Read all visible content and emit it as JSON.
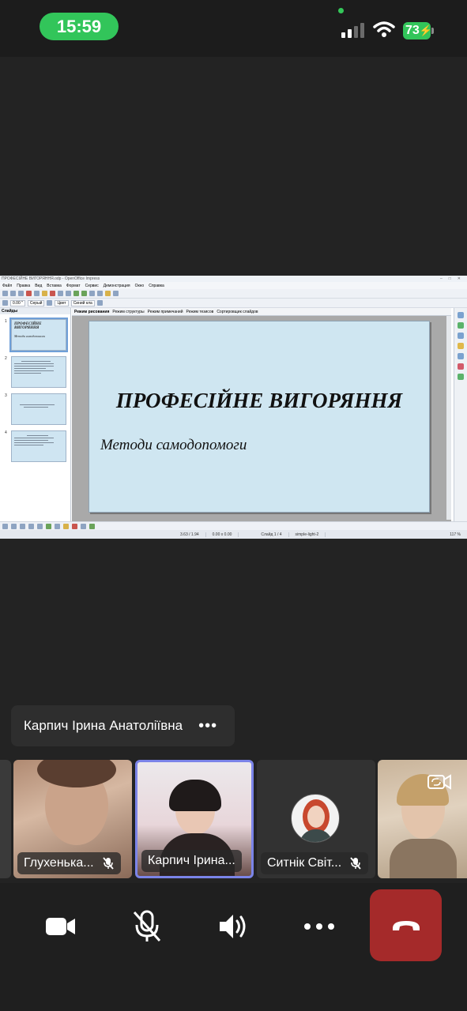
{
  "status": {
    "time": "15:59",
    "battery": "73"
  },
  "colors": {
    "time_pill": "#32c55a",
    "active_border": "#7b84e8",
    "leave_button": "#a52a2a"
  },
  "shared_screen": {
    "window_title": "ПРОФЕСІЙНЕ ВИГОРЯННЯ.odp - OpenOffice Impress",
    "menu": [
      "Файл",
      "Правка",
      "Вид",
      "Вставка",
      "Формат",
      "Сервис",
      "Демонстрация",
      "Окно",
      "Справка"
    ],
    "toolbar_fields": [
      "0.00 \"",
      "Серый",
      "Цвет",
      "Синий кла"
    ],
    "slides_panel_title": "Слайды",
    "view_tabs": [
      "Режим рисования",
      "Режим структуры",
      "Режим примечаний",
      "Режим тезисов",
      "Сортировщик слайдов"
    ],
    "thumbnails": [
      {
        "num": "1",
        "title": "ПРОФЕСІЙНЕ ВИГОРЯННЯ",
        "sub": "Методи самодопомоги"
      },
      {
        "num": "2",
        "title": "",
        "sub": ""
      },
      {
        "num": "3",
        "title": "",
        "sub": ""
      },
      {
        "num": "4",
        "title": "",
        "sub": ""
      }
    ],
    "slide": {
      "title": "ПРОФЕСІЙНЕ ВИГОРЯННЯ",
      "subtitle": "Методи самодопомоги"
    },
    "status_bar": {
      "position": "3.63 / 1.94",
      "size": "0.00 x 0.00",
      "slide": "Слайд 1 / 4",
      "layout": "simple-light-2",
      "zoom": "117 %"
    }
  },
  "active_speaker": {
    "name": "Карпич Ірина Анатоліївна",
    "more": "•••"
  },
  "participants": [
    {
      "name": "",
      "muted": false
    },
    {
      "name": "Глухенька...",
      "muted": true
    },
    {
      "name": "Карпич Ірина...",
      "muted": false
    },
    {
      "name": "Ситнік Світ...",
      "muted": true
    },
    {
      "name": "",
      "muted": false
    }
  ],
  "controls": [
    "video-camera-icon",
    "mic-off-icon",
    "speaker-icon",
    "more-icon",
    "end-call-icon"
  ]
}
